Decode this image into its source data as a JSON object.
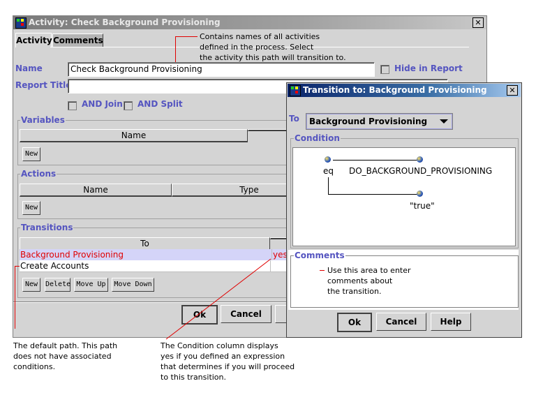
{
  "main_window": {
    "title": "Activity: Check Background Provisioning",
    "close": "✕",
    "tabs": [
      {
        "label": "Activity",
        "active": true
      },
      {
        "label": "Comments",
        "active": false
      }
    ],
    "name_label": "Name",
    "name_value": "Check Background Provisioning",
    "hide_in_report": "Hide in Report",
    "report_title_label": "Report Title",
    "report_title_value": "",
    "and_join": "AND Join",
    "and_split": "AND Split",
    "variables": {
      "title": "Variables",
      "columns": [
        "Name"
      ],
      "new": "New"
    },
    "actions": {
      "title": "Actions",
      "columns": [
        "Name",
        "Type"
      ],
      "new": "New"
    },
    "transitions": {
      "title": "Transitions",
      "columns": [
        "To",
        ""
      ],
      "rows": [
        {
          "to": "Background Provisioning",
          "condition": "yes",
          "selected": true
        },
        {
          "to": "Create Accounts",
          "condition": ""
        }
      ],
      "buttons": [
        "New",
        "Delete",
        "Move Up",
        "Move Down"
      ]
    },
    "ok": "Ok",
    "cancel": "Cancel"
  },
  "dialog": {
    "title": "Transition to: Background Provisioning",
    "close": "✕",
    "to_label": "To",
    "to_value": "Background Provisioning",
    "condition_title": "Condition",
    "tree": {
      "root": "eq",
      "children": [
        "DO_BACKGROUND_PROVISIONING",
        "\"true\""
      ]
    },
    "comments_title": "Comments",
    "ok": "Ok",
    "cancel": "Cancel",
    "help": "Help"
  },
  "annotations": {
    "top": [
      "Contains names of all activities",
      "defined in the process. Select",
      "the activity this path will transition to."
    ],
    "left": [
      "The default path. This path",
      "does not have associated",
      "conditions."
    ],
    "middle": [
      "The Condition column displays",
      "yes if you defined an expression",
      "that determines if you will proceed",
      "to this transition."
    ],
    "comments": [
      "Use this area to enter",
      "comments about",
      "the transition."
    ]
  },
  "colors": {
    "annotation_line": "#e00000",
    "label": "#5555c0",
    "selected_row": "#d4d4f8"
  }
}
